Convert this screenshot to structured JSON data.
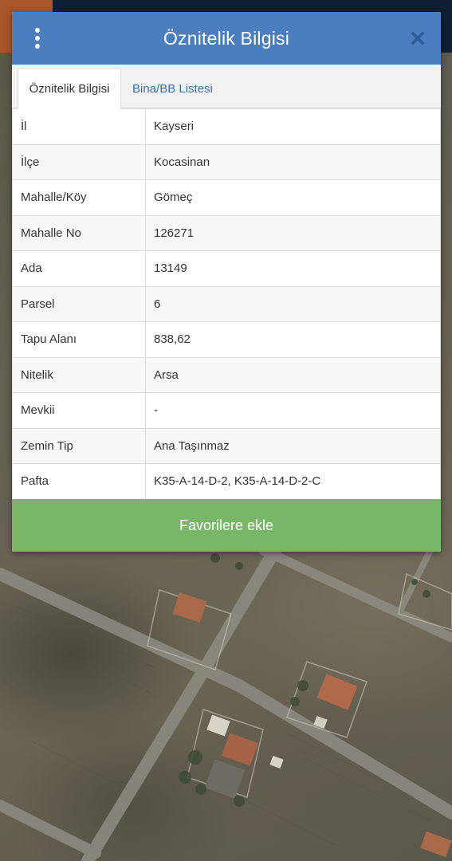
{
  "dialog": {
    "title": "Öznitelik Bilgisi",
    "menu_icon": "vertical-dots-icon",
    "close_icon": "close-icon",
    "header_color": "#4a7ebf"
  },
  "tabs": [
    {
      "label": "Öznitelik Bilgisi",
      "active": true
    },
    {
      "label": "Bina/BB Listesi",
      "active": false
    }
  ],
  "attributes": [
    {
      "label": "İl",
      "value": "Kayseri"
    },
    {
      "label": "İlçe",
      "value": "Kocasinan"
    },
    {
      "label": "Mahalle/Köy",
      "value": "Gömeç"
    },
    {
      "label": "Mahalle No",
      "value": "126271"
    },
    {
      "label": "Ada",
      "value": "13149"
    },
    {
      "label": "Parsel",
      "value": "6"
    },
    {
      "label": "Tapu Alanı",
      "value": "838,62"
    },
    {
      "label": "Nitelik",
      "value": "Arsa"
    },
    {
      "label": "Mevkii",
      "value": "-"
    },
    {
      "label": "Zemin Tip",
      "value": "Ana Taşınmaz"
    },
    {
      "label": "Pafta",
      "value": "K35-A-14-D-2, K35-A-14-D-2-C"
    }
  ],
  "favorite_button": {
    "label": "Favorilere ekle",
    "color": "#77b767"
  },
  "background": "satellite-map"
}
